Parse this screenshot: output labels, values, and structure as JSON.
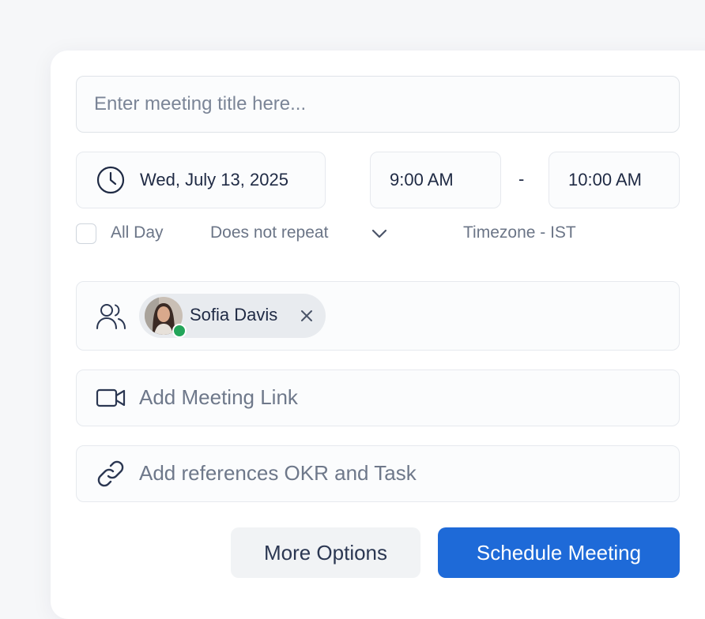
{
  "meeting": {
    "title_placeholder": "Enter meeting title here...",
    "date": "Wed, July 13, 2025",
    "start_time": "9:00 AM",
    "separator": "-",
    "end_time": "10:00 AM",
    "all_day_label": "All Day",
    "repeat_label": "Does not repeat",
    "timezone_label": "Timezone - IST"
  },
  "attendees": [
    {
      "name": "Sofia Davis",
      "status": "online"
    }
  ],
  "meeting_link": {
    "placeholder": "Add Meeting Link"
  },
  "references": {
    "placeholder": "Add references OKR and Task"
  },
  "actions": {
    "more_options": "More Options",
    "schedule": "Schedule Meeting"
  },
  "colors": {
    "primary": "#1e6ad8",
    "presence_online": "#23a55a"
  },
  "icons": {
    "date": "clock-icon",
    "repeat": "chevron-down-icon",
    "attendees": "users-icon",
    "remove": "close-icon",
    "link": "video-icon",
    "references": "link-icon"
  }
}
